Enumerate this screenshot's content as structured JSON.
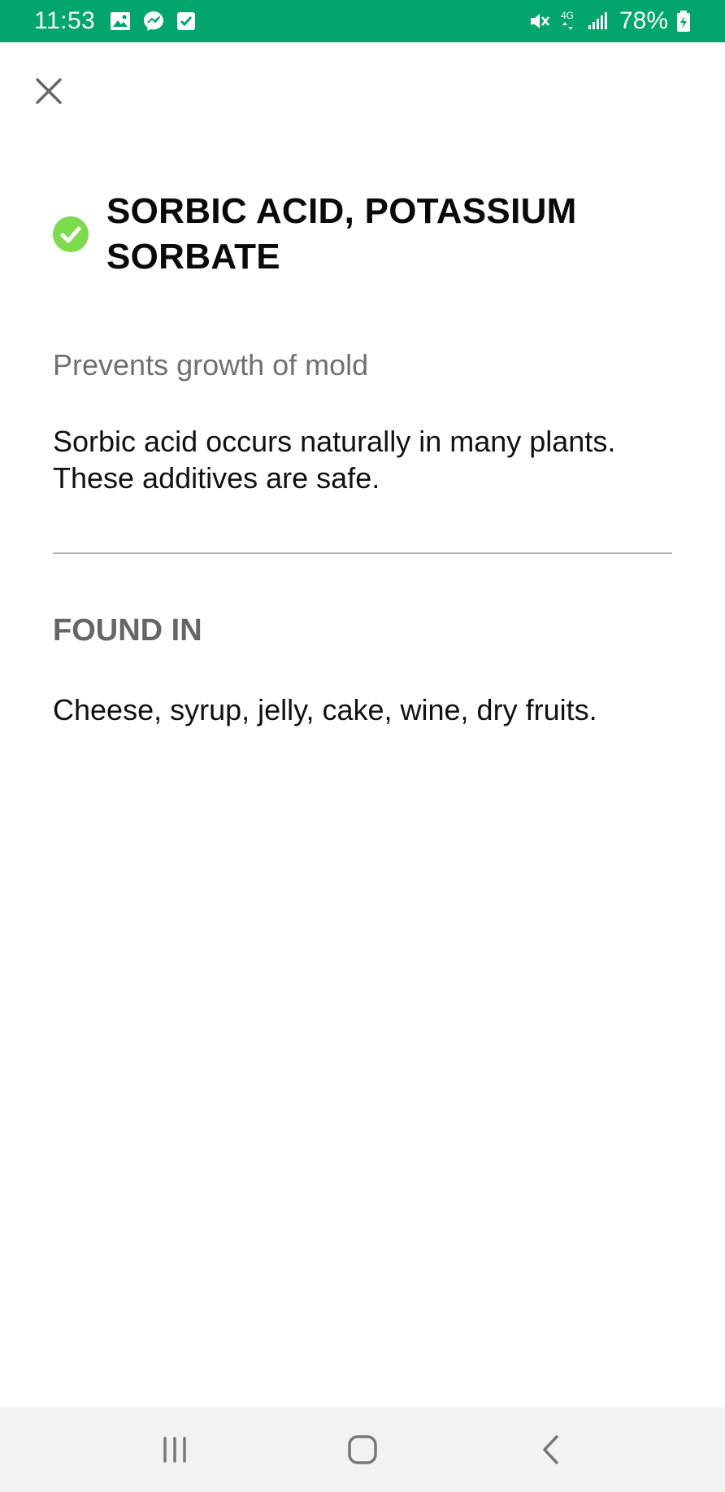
{
  "status_bar": {
    "time": "11:53",
    "battery_percent": "78%",
    "network": "4G",
    "background_color": "#02a56b",
    "left_icons": [
      "gallery-icon",
      "messenger-icon",
      "checkbox-icon"
    ],
    "right_icons": [
      "mute-icon",
      "network-4g-icon",
      "signal-icon",
      "battery-charging-icon"
    ]
  },
  "header": {
    "close_icon": "close-icon"
  },
  "additive": {
    "title": "SORBIC ACID, POTASSIUM SORBATE",
    "status_icon": "check-circle-icon",
    "status_color": "#7ddb4e",
    "subtitle": "Prevents growth of mold",
    "description": "Sorbic acid occurs naturally in many plants. These additives are safe."
  },
  "found_in": {
    "heading": "FOUND IN",
    "text": "Cheese, syrup, jelly, cake, wine, dry fruits."
  },
  "nav_bar": {
    "buttons": [
      "recent-apps-icon",
      "home-icon",
      "back-icon"
    ]
  }
}
